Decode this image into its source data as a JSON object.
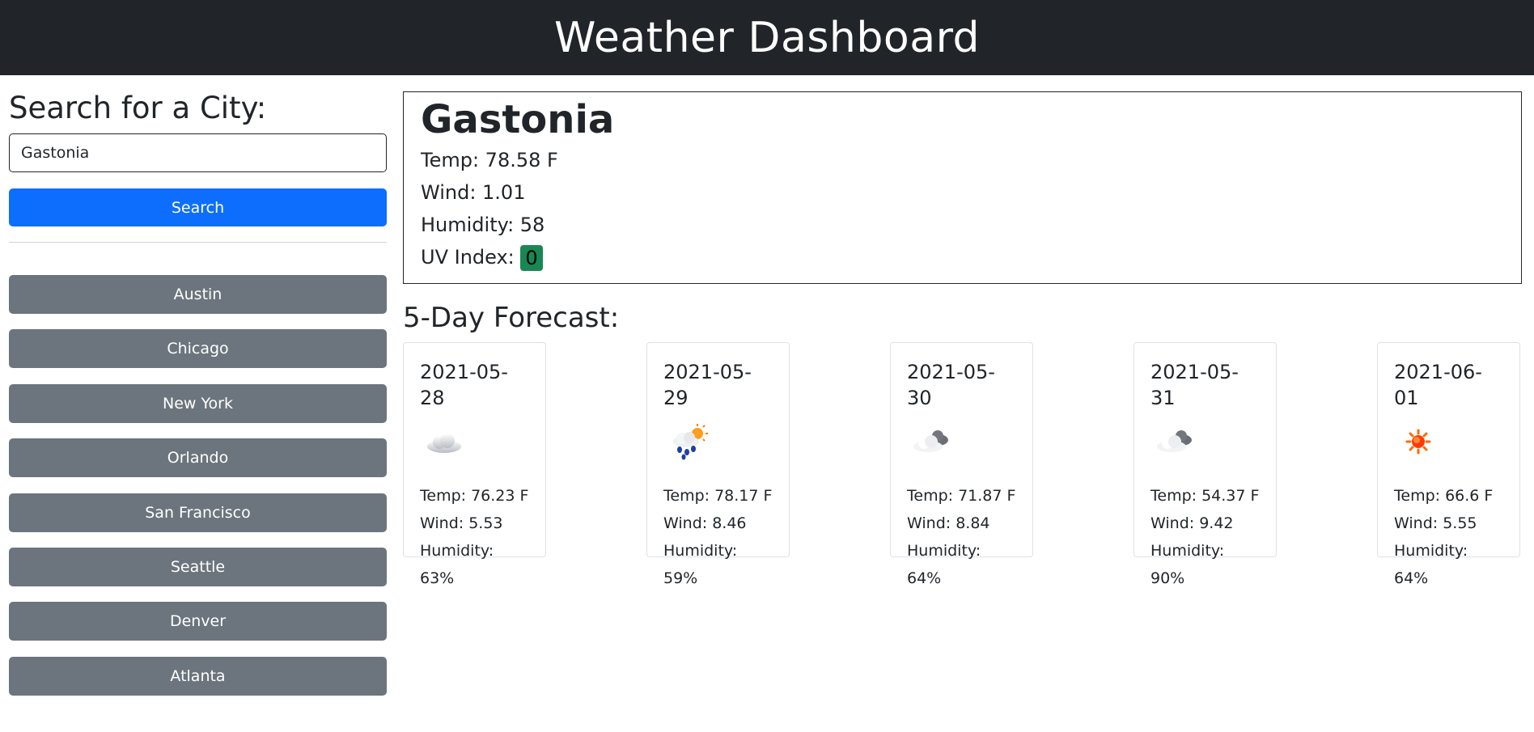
{
  "header": {
    "title": "Weather Dashboard"
  },
  "sidebar": {
    "search_heading": "Search for a City:",
    "search_value": "Gastonia",
    "search_button": "Search",
    "history": [
      "Austin",
      "Chicago",
      "New York",
      "Orlando",
      "San Francisco",
      "Seattle",
      "Denver",
      "Atlanta"
    ]
  },
  "current": {
    "city": "Gastonia",
    "temp": "Temp: 78.58 F",
    "wind": "Wind: 1.01",
    "humidity": "Humidity: 58",
    "uv_label": "UV Index:",
    "uv_value": "0",
    "uv_color": "#198754"
  },
  "forecast": {
    "heading": "5-Day Forecast:",
    "days": [
      {
        "date": "2021-05-28",
        "icon": "cloud-icon",
        "temp": "Temp: 76.23 F",
        "wind": "Wind: 5.53",
        "humidity": "Humidity: 63%"
      },
      {
        "date": "2021-05-29",
        "icon": "rain-sun-icon",
        "temp": "Temp: 78.17 F",
        "wind": "Wind: 8.46",
        "humidity": "Humidity: 59%"
      },
      {
        "date": "2021-05-30",
        "icon": "overcast-cloud-icon",
        "temp": "Temp: 71.87 F",
        "wind": "Wind: 8.84",
        "humidity": "Humidity: 64%"
      },
      {
        "date": "2021-05-31",
        "icon": "overcast-cloud-icon",
        "temp": "Temp: 54.37 F",
        "wind": "Wind: 9.42",
        "humidity": "Humidity: 90%"
      },
      {
        "date": "2021-06-01",
        "icon": "sun-icon",
        "temp": "Temp: 66.6 F",
        "wind": "Wind: 5.55",
        "humidity": "Humidity: 64%"
      }
    ]
  },
  "colors": {
    "header_bg": "#212529",
    "primary": "#0d6efd",
    "secondary": "#6c757d"
  }
}
